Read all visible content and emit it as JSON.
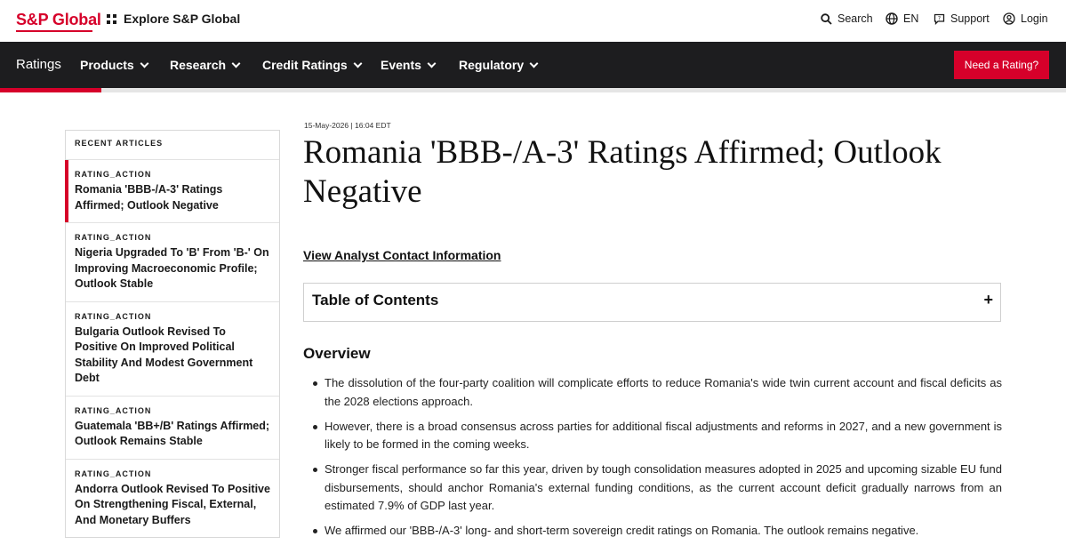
{
  "topbar": {
    "logo": "S&P Global",
    "explore": "Explore S&P Global",
    "search": "Search",
    "language": "EN",
    "support": "Support",
    "login": "Login"
  },
  "nav": {
    "brand": "Ratings",
    "items": [
      "Products",
      "Research",
      "Credit Ratings",
      "Events",
      "Regulatory"
    ],
    "cta": "Need a Rating?",
    "read_progress_percent": 9.5
  },
  "sidebar": {
    "heading": "RECENT ARTICLES",
    "articles": [
      {
        "tag": "RATING_ACTION",
        "title": "Romania 'BBB-/A-3' Ratings Affirmed; Outlook Negative",
        "active": true
      },
      {
        "tag": "RATING_ACTION",
        "title": "Nigeria Upgraded To 'B' From 'B-' On Improving Macroeconomic Profile; Outlook Stable"
      },
      {
        "tag": "RATING_ACTION",
        "title": "Bulgaria Outlook Revised To Positive On Improved Political Stability And Modest Government Debt"
      },
      {
        "tag": "RATING_ACTION",
        "title": "Guatemala 'BB+/B' Ratings Affirmed; Outlook Remains Stable"
      },
      {
        "tag": "RATING_ACTION",
        "title": "Andorra Outlook Revised To Positive On Strengthening Fiscal, External, And Monetary Buffers"
      }
    ]
  },
  "article": {
    "date": "15-May-2026 | 16:04 EDT",
    "title": "Romania 'BBB-/A-3' Ratings Affirmed; Outlook Negative",
    "contact_link": "View Analyst Contact Information",
    "toc_label": "Table of Contents",
    "toc_toggle": "+",
    "overview_heading": "Overview",
    "bullets": [
      "The dissolution of the four-party coalition will complicate efforts to reduce Romania's wide twin current account and fiscal deficits as the 2028 elections approach.",
      "However, there is a broad consensus across parties for additional fiscal adjustments and reforms in 2027, and a new government is likely to be formed in the coming weeks.",
      "Stronger fiscal performance so far this year, driven by tough consolidation measures adopted in 2025 and upcoming sizable EU fund disbursements, should anchor Romania's external funding conditions, as the current account deficit gradually narrows from an estimated 7.9% of GDP last year.",
      "We affirmed our 'BBB-/A-3' long- and short-term sovereign credit ratings on Romania. The outlook remains negative."
    ]
  },
  "colors": {
    "brand_red": "#d6002a",
    "nav_bg": "#1d1d1f"
  }
}
